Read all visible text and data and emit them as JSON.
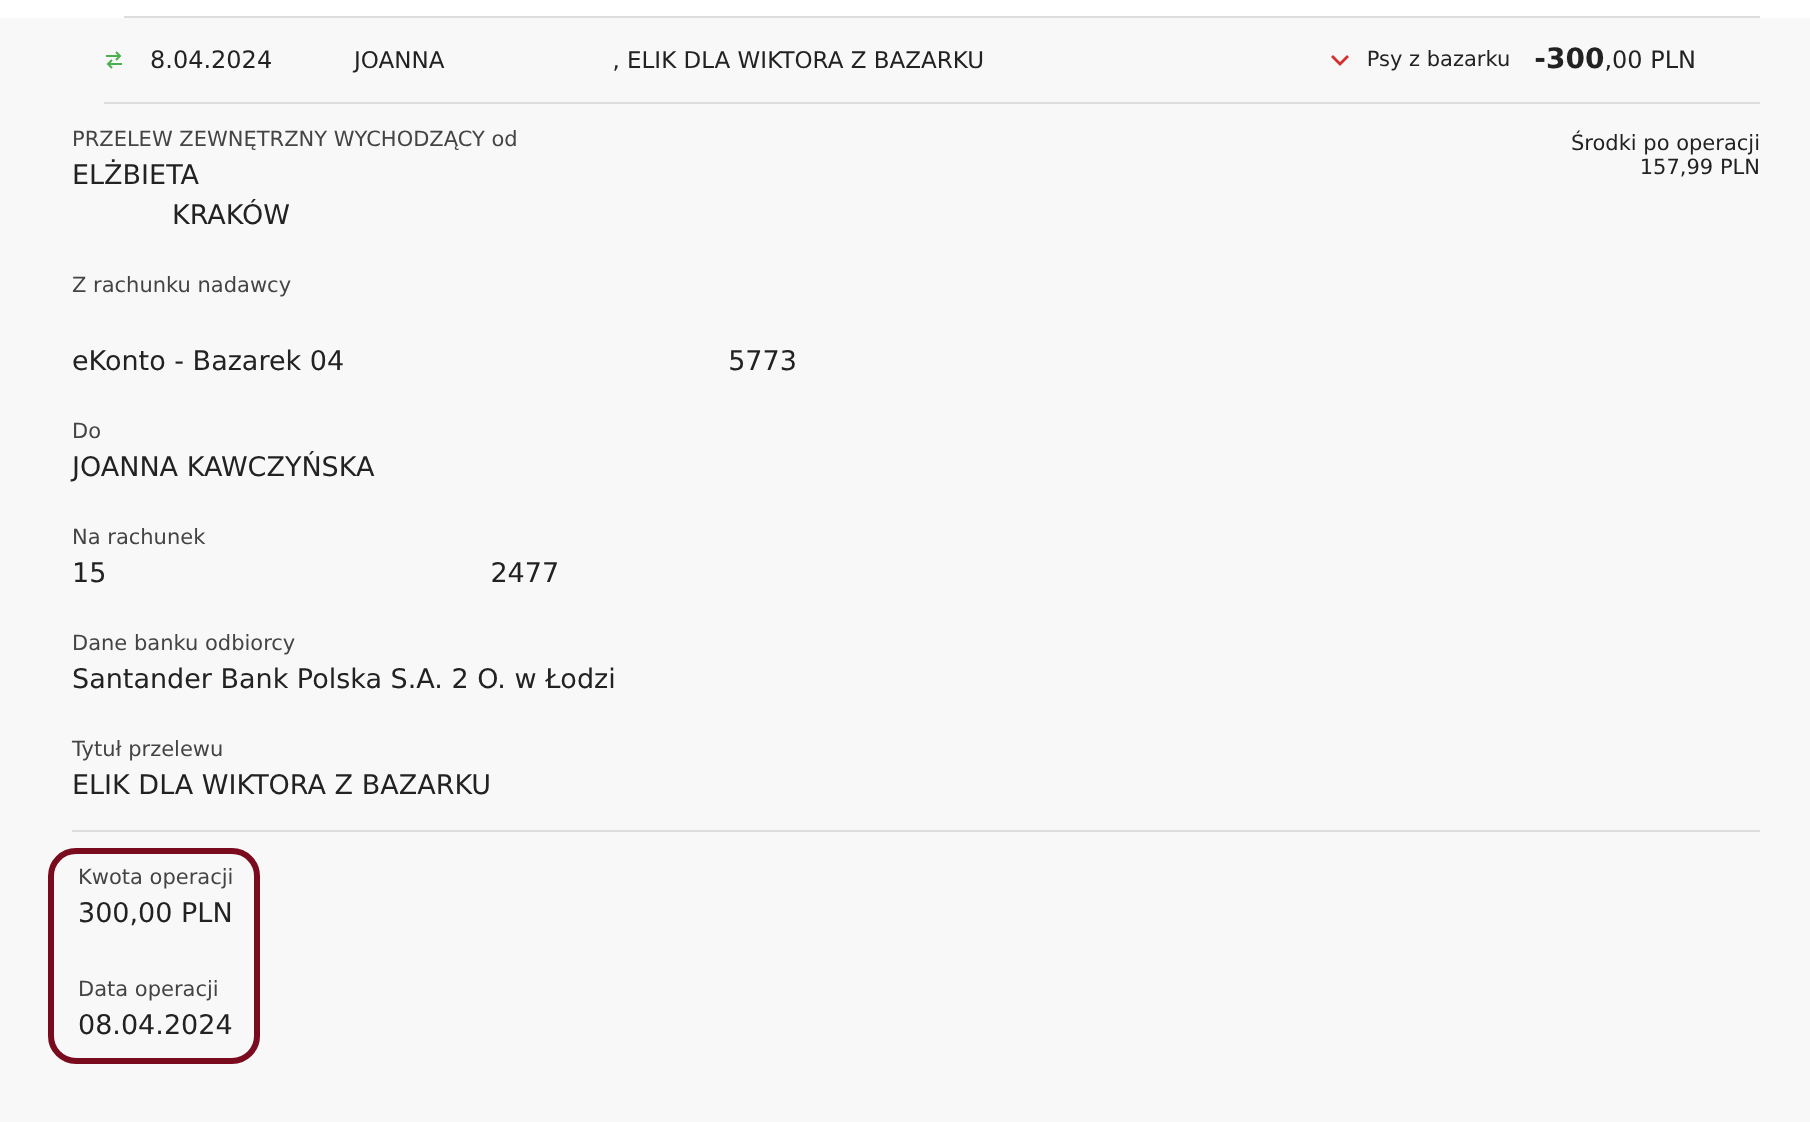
{
  "transaction": {
    "date": "8.04.2024",
    "description": [
      {
        "kind": "text",
        "text": "JOANNA"
      },
      {
        "kind": "redacted"
      },
      {
        "kind": "text",
        "text": ", ELIK DLA WIKTORA Z BAZARKU"
      }
    ],
    "expanded": true,
    "category": "Psy z bazarku",
    "amount": "**-300**,00 PLN"
  },
  "details": [
    {
      "label": "PRZELEW ZEWNĘTRZNY WYCHODZĄCY od",
      "lines": [
        [
          {
            "kind": "text",
            "text": "ELŻBIETA"
          },
          {
            "kind": "redacted"
          }
        ],
        [
          {
            "kind": "redacted"
          },
          {
            "kind": "text",
            "text": "KRAKÓW"
          }
        ]
      ]
    },
    {
      "label": "Z rachunku nadawcy",
      "lines": [
        [
          {
            "kind": "redacted"
          }
        ],
        [
          {
            "kind": "text",
            "text": "eKonto - Bazarek 04"
          },
          {
            "kind": "redacted"
          },
          {
            "kind": "text",
            "text": "5773"
          }
        ]
      ]
    },
    {
      "label": "Do",
      "lines": [
        [
          {
            "kind": "text",
            "text": "JOANNA KAWCZYŃSKA"
          }
        ]
      ]
    },
    {
      "label": "Na rachunek",
      "lines": [
        [
          {
            "kind": "text",
            "text": "15"
          },
          {
            "kind": "redacted"
          },
          {
            "kind": "text",
            "text": "2477"
          }
        ]
      ]
    },
    {
      "label": "Dane banku odbiorcy",
      "lines": [
        [
          {
            "kind": "text",
            "text": "Santander Bank Polska S.A. 2 O. w Łodzi"
          }
        ]
      ]
    },
    {
      "label": "Tytuł przelewu",
      "lines": [
        [
          {
            "kind": "text",
            "text": "ELIK DLA WIKTORA Z BAZARKU"
          }
        ]
      ]
    }
  ],
  "balance": {
    "label": "Środki po operacji",
    "value": "157,99 PLN"
  },
  "summary": {
    "highlighted": true,
    "items": [
      {
        "label": "Kwota operacji",
        "value": "300,00 PLN"
      },
      {
        "label": "Data operacji",
        "value": "08.04.2024"
      }
    ]
  }
}
